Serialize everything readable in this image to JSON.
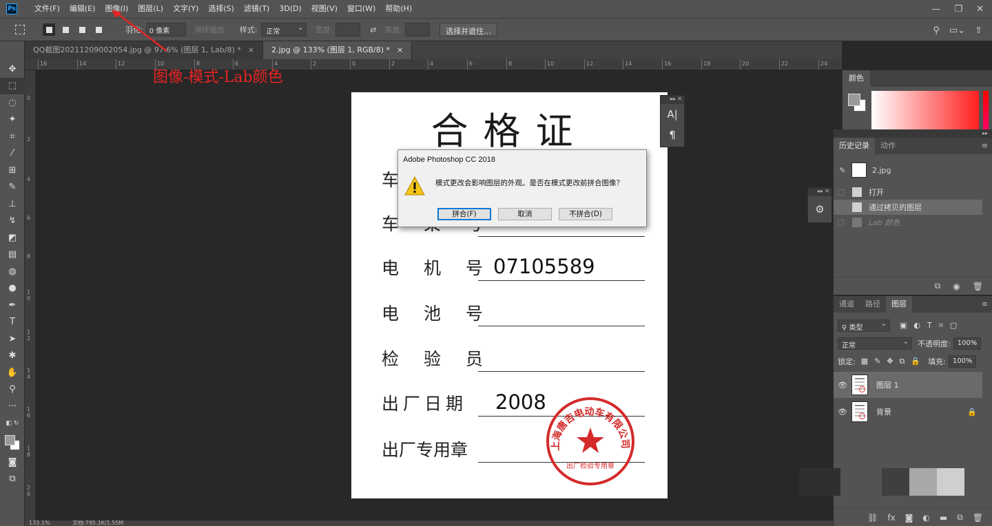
{
  "menubar": {
    "logo": "Ps",
    "items": [
      "文件(F)",
      "编辑(E)",
      "图像(I)",
      "图层(L)",
      "文字(Y)",
      "选择(S)",
      "滤镜(T)",
      "3D(D)",
      "视图(V)",
      "窗口(W)",
      "帮助(H)"
    ],
    "window_controls": [
      "—",
      "❐",
      "✕"
    ]
  },
  "options": {
    "feather_label": "羽化:",
    "feather_value": "0 像素",
    "antialias_label": "消除锯齿",
    "style_label": "样式:",
    "style_value": "正常",
    "width_label": "宽度:",
    "height_label": "高度:",
    "select_mask_button": "选择并遮住..."
  },
  "tabs": [
    {
      "label": "QQ截图20211209002054.jpg @ 97.6% (图层 1, Lab/8) *",
      "close": "×"
    },
    {
      "label": "2.jpg @ 133% (图层 1, RGB/8) *",
      "close": "×"
    }
  ],
  "ruler": {
    "h_ticks": [
      "16",
      "14",
      "12",
      "10",
      "8",
      "6",
      "4",
      "2",
      "0",
      "2",
      "4",
      "6",
      "8",
      "10",
      "12",
      "14",
      "16",
      "18",
      "20",
      "22",
      "24"
    ],
    "v_ticks": [
      "0",
      "2",
      "4",
      "6",
      "8",
      "1 0",
      "1 2",
      "1 4",
      "1 6",
      "1 8",
      "2 0"
    ]
  },
  "annotation": "图像-模式-Lab颜色",
  "document": {
    "title": "合格证",
    "rows": [
      {
        "label": "车",
        "value": ""
      },
      {
        "label": "车 架 号",
        "value": ""
      },
      {
        "label": "电 机 号",
        "value": "07105589"
      },
      {
        "label": "电 池 号",
        "value": ""
      },
      {
        "label": "检 验 员",
        "value": ""
      },
      {
        "label": "出厂日期",
        "value": "2008"
      },
      {
        "label": "出厂专用章",
        "value": ""
      }
    ],
    "stamp_top": "上海唐吉电动车有限公司",
    "stamp_bottom": "出厂检验专用章",
    "stamp_color": "#d42a2a"
  },
  "dialog": {
    "title": "Adobe Photoshop CC 2018",
    "message": "模式更改会影响图层的外观。是否在模式更改前拼合图像？",
    "buttons": {
      "flatten": "拼合(F)",
      "cancel": "取消",
      "dont_flatten": "不拼合(D)"
    }
  },
  "panels": {
    "color_tab": "颜色",
    "history_tabs": [
      "历史记录",
      "动作"
    ],
    "history_snapshot": "2.jpg",
    "history_items": [
      "打开",
      "通过拷贝的图层",
      "Lab 颜色"
    ],
    "layers_tabs": [
      "通道",
      "路径",
      "图层"
    ],
    "filter_kind": "类型",
    "blend_mode": "正常",
    "opacity_label": "不透明度:",
    "opacity_value": "100%",
    "lock_label": "锁定:",
    "fill_label": "填充:",
    "fill_value": "100%",
    "layers": [
      {
        "name": "图层 1"
      },
      {
        "name": "背景"
      }
    ]
  },
  "status": {
    "zoom": "133.1%",
    "doc_info": "文档:795.1K/1.55M"
  }
}
